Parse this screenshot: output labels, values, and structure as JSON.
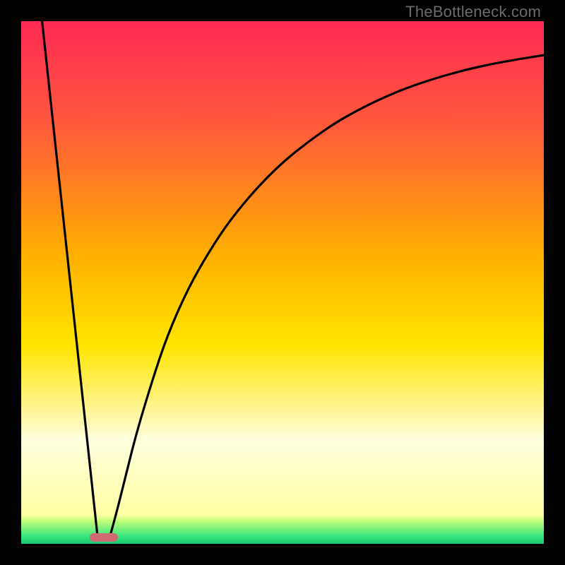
{
  "watermark": "TheBottleneck.com",
  "chart_data": {
    "type": "line",
    "title": "",
    "xlabel": "",
    "ylabel": "",
    "xlim": [
      0,
      100
    ],
    "ylim": [
      0,
      100
    ],
    "grid": false,
    "legend": false,
    "gradient_stops": [
      {
        "offset": 0,
        "color": "#ff2a55"
      },
      {
        "offset": 0.2,
        "color": "#ff5a3c"
      },
      {
        "offset": 0.45,
        "color": "#ffb000"
      },
      {
        "offset": 0.62,
        "color": "#ffe500"
      },
      {
        "offset": 0.78,
        "color": "#fffac2"
      },
      {
        "offset": 0.8,
        "color": "#ffffdf"
      },
      {
        "offset": 0.945,
        "color": "#ffffa3"
      },
      {
        "offset": 0.955,
        "color": "#c7ff7a"
      },
      {
        "offset": 0.985,
        "color": "#39e67e"
      },
      {
        "offset": 1.0,
        "color": "#19c86b"
      }
    ],
    "series": [
      {
        "name": "left_v_line",
        "x": [
          4.0,
          14.6
        ],
        "y": [
          100,
          1.5
        ]
      },
      {
        "name": "right_curve",
        "x": [
          17,
          18,
          20,
          22,
          25,
          28,
          32,
          36,
          40,
          45,
          50,
          55,
          60,
          65,
          70,
          75,
          80,
          85,
          90,
          95,
          100
        ],
        "y": [
          1.5,
          5,
          13,
          21,
          31,
          40,
          49,
          56,
          62,
          68,
          73,
          77,
          80.5,
          83.3,
          85.7,
          87.7,
          89.3,
          90.7,
          91.8,
          92.7,
          93.5
        ]
      }
    ],
    "marker": {
      "name": "optimal_marker",
      "x_center": 15.8,
      "width_pct": 5.4,
      "y": 1.2,
      "color": "#cf6a72"
    }
  }
}
